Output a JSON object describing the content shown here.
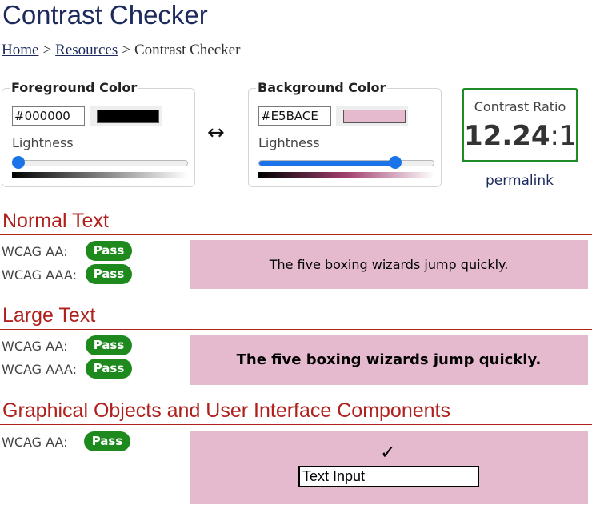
{
  "page": {
    "title": "Contrast Checker",
    "breadcrumb": [
      {
        "label": "Home",
        "link": true
      },
      {
        "label": "Resources",
        "link": true
      },
      {
        "label": "Contrast Checker",
        "link": false
      }
    ],
    "breadcrumb_separator": ">"
  },
  "foreground": {
    "legend": "Foreground Color",
    "hex": "#000000",
    "swatch_color": "#000000",
    "lightness_label": "Lightness",
    "lightness_percent": 0,
    "gradient": [
      "#000000",
      "#ffffff"
    ]
  },
  "background": {
    "legend": "Background Color",
    "hex": "#E5BACE",
    "swatch_color": "#E5BACE",
    "lightness_label": "Lightness",
    "lightness_percent": 80,
    "gradient": [
      "#000000",
      "#a23f6f",
      "#ffffff"
    ]
  },
  "swap": {
    "icon": "left-right-arrow-icon",
    "glyph": "↔"
  },
  "contrast": {
    "label": "Contrast Ratio",
    "ratio_main": "12.24",
    "ratio_suffix": ":1",
    "permalink": "permalink",
    "border_color": "#1e8b24"
  },
  "sections": {
    "normal": {
      "title": "Normal Text",
      "aa_label": "WCAG AA:",
      "aa_result": "Pass",
      "aaa_label": "WCAG AAA:",
      "aaa_result": "Pass",
      "sample": "The five boxing wizards jump quickly."
    },
    "large": {
      "title": "Large Text",
      "aa_label": "WCAG AA:",
      "aa_result": "Pass",
      "aaa_label": "WCAG AAA:",
      "aaa_result": "Pass",
      "sample": "The five boxing wizards jump quickly."
    },
    "graphical": {
      "title": "Graphical Objects and User Interface Components",
      "aa_label": "WCAG AA:",
      "aa_result": "Pass",
      "checkmark": "✓",
      "input_value": "Text Input"
    }
  },
  "colors": {
    "heading": "#1d2a5e",
    "section_red": "#b0211d",
    "pass_green": "#1e8a1e",
    "slider_blue": "#1a73e8",
    "sample_bg": "#E5BACE",
    "sample_fg": "#000000"
  }
}
